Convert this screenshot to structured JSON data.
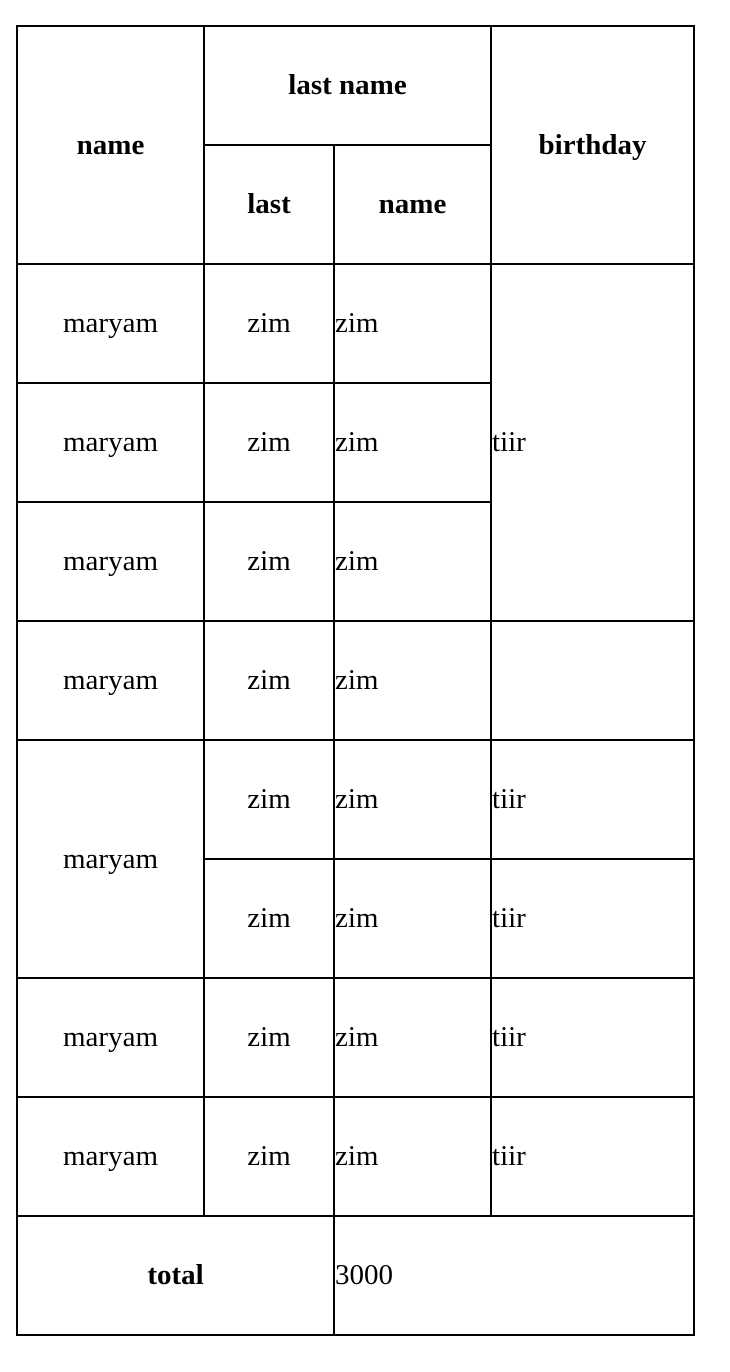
{
  "table": {
    "headers": {
      "name": "name",
      "last_name": "last name",
      "last": "last",
      "name_sub": "name",
      "birthday": "birthday"
    },
    "rows": [
      {
        "name": "maryam",
        "last": "zim",
        "name2": "zim",
        "birthday": "tiir"
      },
      {
        "name": "maryam",
        "last": "zim",
        "name2": "zim"
      },
      {
        "name": "maryam",
        "last": "zim",
        "name2": "zim"
      },
      {
        "name": "maryam",
        "last": "zim",
        "name2": "zim",
        "birthday": ""
      },
      {
        "name": "maryam",
        "last": "zim",
        "name2": "zim",
        "birthday": "tiir"
      },
      {
        "last": "zim",
        "name2": "zim",
        "birthday": "tiir"
      },
      {
        "name": "maryam",
        "last": "zim",
        "name2": "zim",
        "birthday": "tiir"
      },
      {
        "name": "maryam",
        "last": "zim",
        "name2": "zim",
        "birthday": "tiir"
      }
    ],
    "footer": {
      "label": "total",
      "value": "3000"
    }
  }
}
